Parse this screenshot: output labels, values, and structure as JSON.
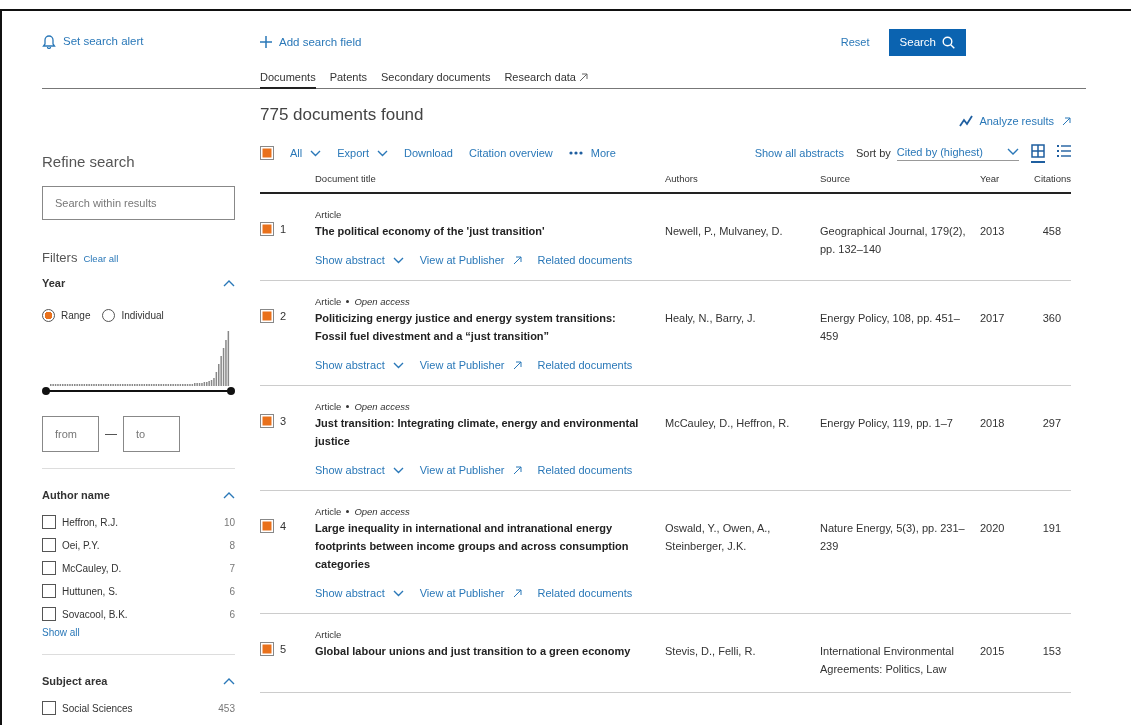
{
  "top": {
    "alert_link": "Set search alert",
    "add_field": "Add search field",
    "reset": "Reset",
    "search": "Search"
  },
  "tabs": [
    {
      "label": "Documents",
      "selected": true,
      "external": false
    },
    {
      "label": "Patents",
      "selected": false,
      "external": false
    },
    {
      "label": "Secondary documents",
      "selected": false,
      "external": false
    },
    {
      "label": "Research data",
      "selected": false,
      "external": true
    }
  ],
  "sidebar": {
    "title": "Refine search",
    "search": {
      "placeholder": "Search within results"
    },
    "filters": "Filters",
    "clear_all": "Clear all",
    "sections": [
      {
        "kind": "year",
        "title": "Year",
        "expanded": true,
        "radios": [
          {
            "label": "Range",
            "selected": true
          },
          {
            "label": "Individual",
            "selected": false
          }
        ],
        "from": {
          "placeholder": "from"
        },
        "to": {
          "placeholder": "to"
        }
      },
      {
        "kind": "list",
        "title": "Author name",
        "expanded": true,
        "items": [
          {
            "label": "Heffron, R.J.",
            "count": "10",
            "checked": false
          },
          {
            "label": "Oei, P.Y.",
            "count": "8",
            "checked": false
          },
          {
            "label": "McCauley, D.",
            "count": "7",
            "checked": false
          },
          {
            "label": "Huttunen, S.",
            "count": "6",
            "checked": false
          },
          {
            "label": "Sovacool, B.K.",
            "count": "6",
            "checked": false
          }
        ],
        "show_all": "Show all"
      },
      {
        "kind": "list",
        "title": "Subject area",
        "expanded": true,
        "items": [
          {
            "label": "Social Sciences",
            "count": "453",
            "checked": false
          }
        ]
      }
    ]
  },
  "results": {
    "count": "775 documents found",
    "analyze": "Analyze results",
    "toolbar": {
      "select_all": {
        "checked": true
      },
      "all": "All",
      "export": "Export",
      "download": "Download",
      "citation": "Citation overview",
      "more": "More",
      "show_abstracts": "Show all abstracts",
      "sort_label": "Sort by",
      "sort_value": "Cited by (highest)",
      "views": [
        {
          "kind": "grid",
          "selected": true
        },
        {
          "kind": "list",
          "selected": false
        }
      ]
    },
    "columns": [
      "Document title",
      "Authors",
      "Source",
      "Year",
      "Citations"
    ],
    "rows": [
      {
        "checked": true,
        "number": "1",
        "doc_type": "Article",
        "title": "The political economy of the 'just transition'",
        "authors": "Newell, P., Mulvaney, D.",
        "source": "Geographical Journal, 179(2), pp. 132–140",
        "year": "2013",
        "citations": "458",
        "links": [
          "Show abstract",
          "View at Publisher",
          "Related documents"
        ]
      },
      {
        "checked": true,
        "number": "2",
        "doc_type": "Article",
        "access": "Open access",
        "title": "Politicizing energy justice and energy system transitions: Fossil fuel divestment and a “just transition”",
        "authors": "Healy, N., Barry, J.",
        "source": "Energy Policy, 108, pp. 451–459",
        "year": "2017",
        "citations": "360",
        "links": [
          "Show abstract",
          "View at Publisher",
          "Related documents"
        ]
      },
      {
        "checked": true,
        "number": "3",
        "doc_type": "Article",
        "access": "Open access",
        "title": "Just transition: Integrating climate, energy and environmental justice",
        "authors": "McCauley, D., Heffron, R.",
        "source": "Energy Policy, 119, pp. 1–7",
        "year": "2018",
        "citations": "297",
        "links": [
          "Show abstract",
          "View at Publisher",
          "Related documents"
        ]
      },
      {
        "checked": true,
        "number": "4",
        "doc_type": "Article",
        "access": "Open access",
        "title": "Large inequality in international and intranational energy footprints between income groups and across consumption categories",
        "authors": "Oswald, Y., Owen, A., Steinberger, J.K.",
        "source": "Nature Energy, 5(3), pp. 231–239",
        "year": "2020",
        "citations": "191",
        "links": [
          "Show abstract",
          "View at Publisher",
          "Related documents"
        ]
      },
      {
        "checked": true,
        "number": "5",
        "doc_type": "Article",
        "title": "Global labour unions and just transition to a green economy",
        "authors": "Stevis, D., Felli, R.",
        "source": "International Environmental Agreements: Politics, Law",
        "year": "2015",
        "citations": "153",
        "links": []
      }
    ]
  }
}
